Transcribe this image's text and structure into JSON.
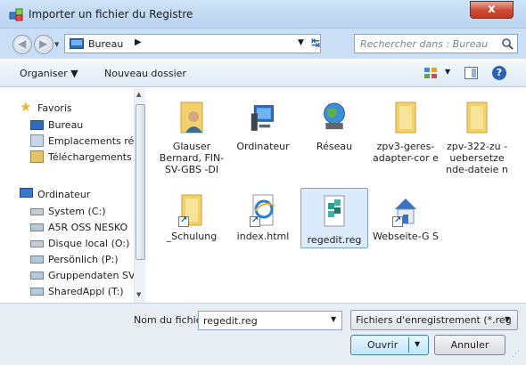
{
  "window": {
    "title": "Importer un fichier du Registre",
    "close_label": "x"
  },
  "address": {
    "location": "Bureau",
    "chevron": "▶",
    "search_placeholder": "Rechercher dans : Bureau"
  },
  "toolbar": {
    "organize": "Organiser ▼",
    "new_folder": "Nouveau dossier"
  },
  "nav": {
    "favorites_header": "Favoris",
    "favorites": [
      "Bureau",
      "Emplacements ré",
      "Téléchargements"
    ],
    "computer_header": "Ordinateur",
    "drives": [
      "System (C:)",
      "A5R OSS NESKO",
      "Disque local (O:)",
      "Persönlich (P:)",
      "Gruppendaten SV",
      "SharedAppl (T:)"
    ]
  },
  "files": [
    {
      "label": "Glauser Bernard, FIN-SV-GBS -DI",
      "icon": "user-folder-icon"
    },
    {
      "label": "Ordinateur",
      "icon": "computer-icon"
    },
    {
      "label": "Réseau",
      "icon": "network-globe-icon"
    },
    {
      "label": "zpv3-geres-adapter-cor e",
      "icon": "folder-icon"
    },
    {
      "label": "zpv-322-zu -uebersetze nde-dateie n",
      "icon": "folder-icon"
    },
    {
      "label": "_Schulung",
      "icon": "folder-shortcut-icon"
    },
    {
      "label": "index.html",
      "icon": "ie-document-icon"
    },
    {
      "label": "regedit.reg",
      "icon": "registry-file-icon"
    },
    {
      "label": "Webseite-G S",
      "icon": "house-shortcut-icon"
    }
  ],
  "footer": {
    "filename_label": "Nom du fichier :",
    "filename_value": "regedit.reg",
    "filter_value": "Fichiers d'enregistrement (*.reg",
    "open_label": "Ouvrir",
    "cancel_label": "Annuler"
  }
}
